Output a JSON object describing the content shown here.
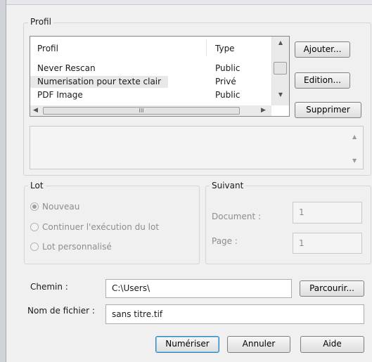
{
  "profil": {
    "legend": "Profil",
    "columns": [
      "Profil",
      "Type"
    ],
    "rows": [
      {
        "name": "Never Rescan",
        "type": "Public"
      },
      {
        "name": "Numerisation pour texte clair",
        "type": "Privé"
      },
      {
        "name": "PDF Image",
        "type": "Public"
      }
    ],
    "buttons": {
      "add": "Ajouter...",
      "edit": "Edition...",
      "delete": "Supprimer"
    }
  },
  "lot": {
    "legend": "Lot",
    "options": [
      "Nouveau",
      "Continuer l'exécution du lot",
      "Lot personnalisé"
    ],
    "selected": "Nouveau"
  },
  "suivant": {
    "legend": "Suivant",
    "document_label": "Document :",
    "document_value": "1",
    "page_label": "Page :",
    "page_value": "1"
  },
  "chemin": {
    "label": "Chemin :",
    "value": "C:\\Users\\",
    "browse": "Parcourir..."
  },
  "fichier": {
    "label": "Nom de fichier :",
    "value": "sans titre.tif"
  },
  "actions": {
    "scan": "Numériser",
    "cancel": "Annuler",
    "help": "Aide"
  }
}
